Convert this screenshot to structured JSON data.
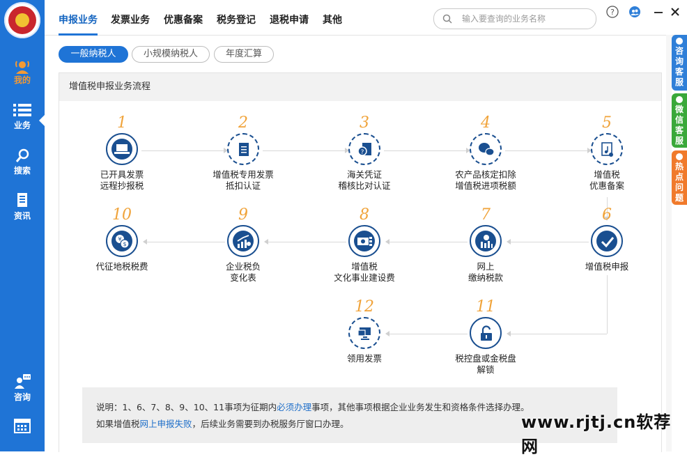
{
  "sidebar": {
    "items": [
      {
        "label": "我的",
        "icon": "user-broadcast-icon"
      },
      {
        "label": "业务",
        "icon": "list-icon"
      },
      {
        "label": "搜索",
        "icon": "magnifier-icon"
      },
      {
        "label": "资讯",
        "icon": "document-icon"
      },
      {
        "label": "咨询",
        "icon": "chat-user-icon"
      },
      {
        "label": "",
        "icon": "calendar-icon"
      }
    ]
  },
  "topnav": {
    "tabs": [
      "申报业务",
      "发票业务",
      "优惠备案",
      "税务登记",
      "退税申请",
      "其他"
    ],
    "search_placeholder": "输入要查询的业务名称"
  },
  "subtabs": [
    "一般纳税人",
    "小规模纳税人",
    "年度汇算"
  ],
  "panel": {
    "title": "增值税申报业务流程",
    "steps": [
      {
        "num": "1",
        "line1": "已开具发票",
        "line2": "远程抄报税"
      },
      {
        "num": "2",
        "line1": "增值税专用发票",
        "line2": "抵扣认证"
      },
      {
        "num": "3",
        "line1": "海关凭证",
        "line2": "稽核比对认证"
      },
      {
        "num": "4",
        "line1": "农产品核定扣除",
        "line2": "增值税进项税额"
      },
      {
        "num": "5",
        "line1": "增值税",
        "line2": "优惠备案"
      },
      {
        "num": "6",
        "line1": "增值税申报",
        "line2": ""
      },
      {
        "num": "7",
        "line1": "网上",
        "line2": "缴纳税款"
      },
      {
        "num": "8",
        "line1": "增值税",
        "line2": "文化事业建设费"
      },
      {
        "num": "9",
        "line1": "企业税负",
        "line2": "变化表"
      },
      {
        "num": "10",
        "line1": "代征地税税费",
        "line2": ""
      },
      {
        "num": "11",
        "line1": "税控盘或金税盘",
        "line2": "解锁"
      },
      {
        "num": "12",
        "line1": "领用发票",
        "line2": ""
      }
    ]
  },
  "note": {
    "line1_a": "说明：1、6、7、8、9、10、11事项为征期内",
    "line1_link": "必须办理",
    "line1_b": "事项，其他事项根据企业业务发生和资格条件选择办理。",
    "line2_a": "如果增值税",
    "line2_link": "网上申报失败",
    "line2_b": "，后续业务需要到办税服务厅窗口办理。"
  },
  "right_tabs": [
    {
      "label": "咨询客服",
      "color": "#2f7fd8"
    },
    {
      "label": "微信客服",
      "color": "#3aa83a"
    },
    {
      "label": "热点问题",
      "color": "#f07a2b"
    }
  ],
  "watermark": "www.rjtj.cn软荐网",
  "colors": {
    "primary": "#1f74d6",
    "accent": "#f39a35",
    "icon_dark": "#1a4f90"
  }
}
